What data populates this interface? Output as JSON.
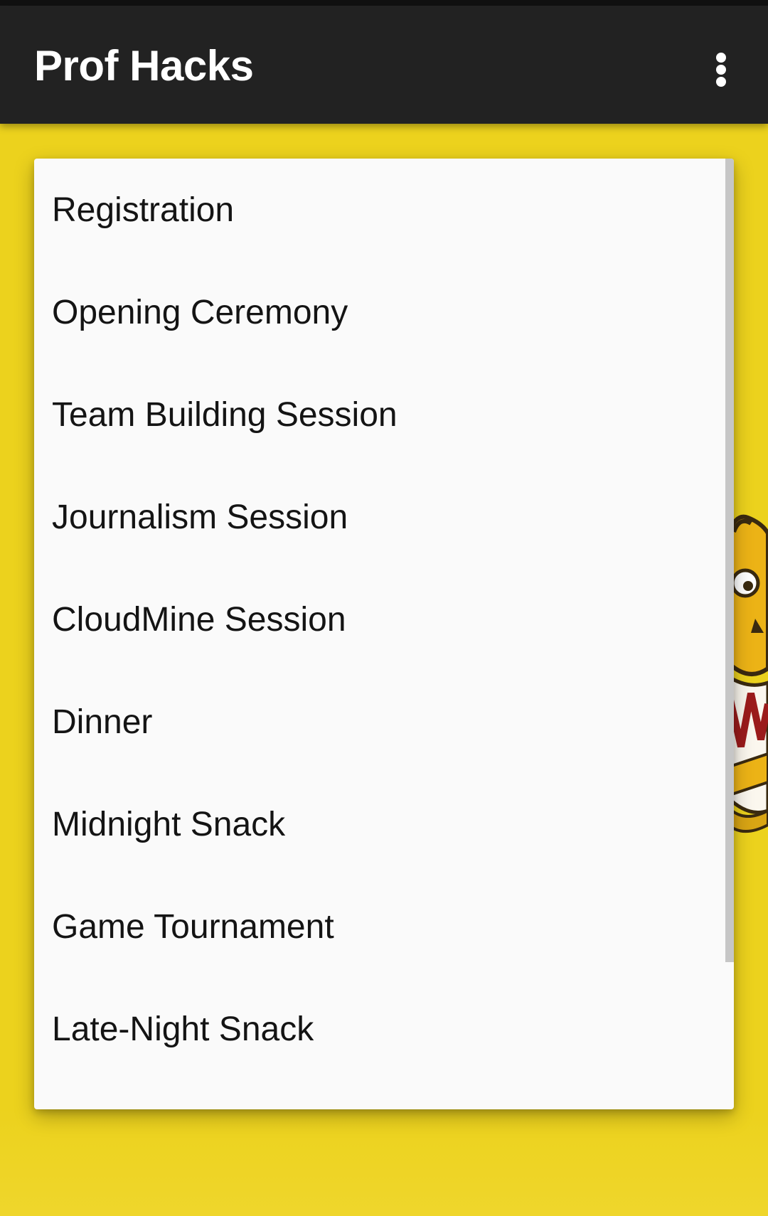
{
  "app_bar": {
    "title": "Prof Hacks",
    "overflow_icon": "more-vertical-icon",
    "background_color": "#222222",
    "title_color": "#ffffff"
  },
  "background": {
    "color": "#ecd21d",
    "decoration": "mascot-logo"
  },
  "menu": {
    "items": [
      {
        "label": "Registration"
      },
      {
        "label": "Opening Ceremony"
      },
      {
        "label": "Team Building Session"
      },
      {
        "label": "Journalism Session"
      },
      {
        "label": "CloudMine Session"
      },
      {
        "label": "Dinner"
      },
      {
        "label": "Midnight Snack"
      },
      {
        "label": "Game Tournament"
      },
      {
        "label": "Late-Night Snack"
      }
    ],
    "background_color": "#fafafa",
    "scroll_position": 0
  }
}
